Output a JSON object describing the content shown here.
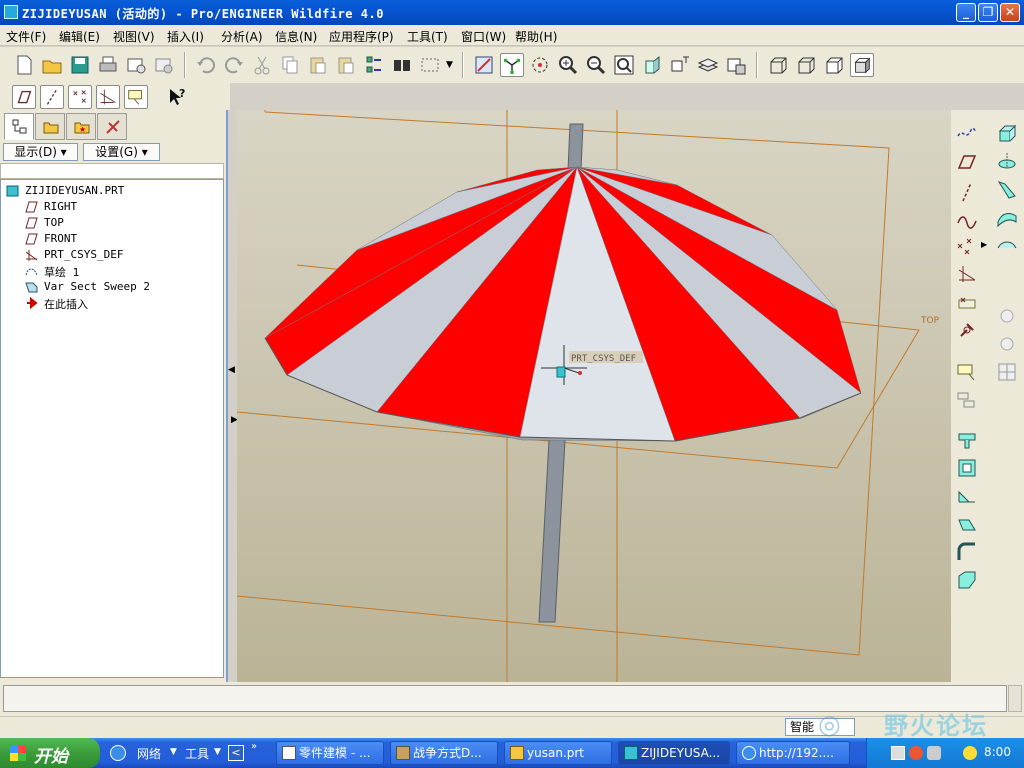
{
  "window": {
    "title": "ZIJIDEYUSAN (活动的) - Pro/ENGINEER Wildfire 4.0"
  },
  "menu": [
    {
      "label": "文件(F)"
    },
    {
      "label": "编辑(E)"
    },
    {
      "label": "视图(V)"
    },
    {
      "label": "插入(I)"
    },
    {
      "label": "分析(A)"
    },
    {
      "label": "信息(N)"
    },
    {
      "label": "应用程序(P)"
    },
    {
      "label": "工具(T)"
    },
    {
      "label": "窗口(W)"
    },
    {
      "label": "帮助(H)"
    }
  ],
  "panel": {
    "show_label": "显示(D) ▾",
    "settings_label": "设置(G) ▾"
  },
  "tree": [
    {
      "label": "ZIJIDEYUSAN.PRT",
      "icon": "part-icon"
    },
    {
      "label": "RIGHT",
      "icon": "datum-plane-icon"
    },
    {
      "label": "TOP",
      "icon": "datum-plane-icon"
    },
    {
      "label": "FRONT",
      "icon": "datum-plane-icon"
    },
    {
      "label": "PRT_CSYS_DEF",
      "icon": "csys-icon"
    },
    {
      "label": "草绘 1",
      "icon": "sketch-icon"
    },
    {
      "label": "Var Sect Sweep 2",
      "icon": "sweep-icon"
    },
    {
      "label": "在此插入",
      "icon": "insert-arrow-icon"
    }
  ],
  "viewport": {
    "csys_label": "PRT_CSYS_DEF",
    "plane_label": "TOP",
    "colors": {
      "red": "#ff0000",
      "white": "#c8cdd6",
      "rod": "#8c939c"
    }
  },
  "status": {
    "filter": "智能"
  },
  "taskbar": {
    "start_label": "开始",
    "quick": [
      "网络",
      "工具"
    ],
    "tasks": [
      {
        "label": "零件建模 - ..."
      },
      {
        "label": "战争方式D..."
      },
      {
        "label": "yusan.prt"
      },
      {
        "label": "ZIJIDEYUSA..."
      },
      {
        "label": "http://192...."
      }
    ],
    "clock": "8:00",
    "watermark": "野火论坛"
  }
}
